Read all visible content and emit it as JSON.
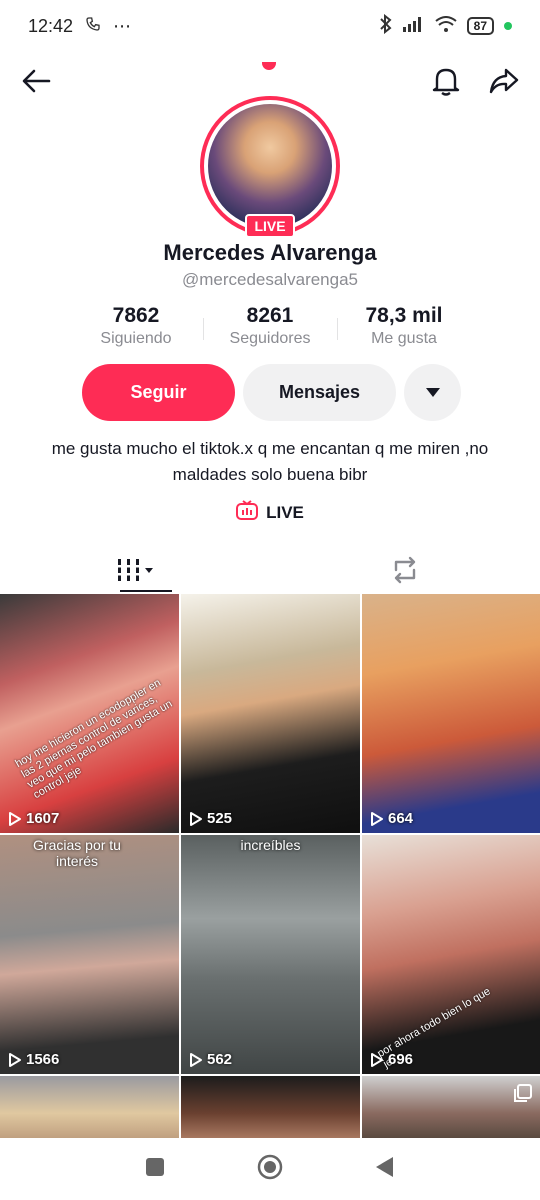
{
  "status_bar": {
    "time": "12:42",
    "extra": "⋯",
    "battery": "87"
  },
  "profile": {
    "live_badge": "LIVE",
    "name": "Mercedes Alvarenga",
    "handle": "@mercedesalvarenga5",
    "stats": [
      {
        "value": "7862",
        "label": "Siguiendo"
      },
      {
        "value": "8261",
        "label": "Seguidores"
      },
      {
        "value": "78,3 mil",
        "label": "Me gusta"
      }
    ],
    "follow_label": "Seguir",
    "message_label": "Mensajes",
    "bio": "me gusta mucho el tiktok.x q me encantan q me miren ,no maldades solo buena bibr",
    "live_link": "LIVE"
  },
  "videos": [
    {
      "views": "1607",
      "caption": "",
      "overlay": "hoy me hicieron un ecodoppler en las 2 piernas control de varices, veo que mi pelo tambien gusta un control jeje"
    },
    {
      "views": "525",
      "caption": "",
      "overlay": ""
    },
    {
      "views": "664",
      "caption": "",
      "overlay": ""
    },
    {
      "views": "1566",
      "caption": "Gracias por tu interés",
      "overlay": ""
    },
    {
      "views": "562",
      "caption": "increíbles",
      "overlay": ""
    },
    {
      "views": "696",
      "caption": "",
      "overlay": "por ahora todo bien lo que je"
    }
  ],
  "colors": {
    "accent": "#fe2c55",
    "text": "#161823",
    "muted": "#8a8b91"
  }
}
